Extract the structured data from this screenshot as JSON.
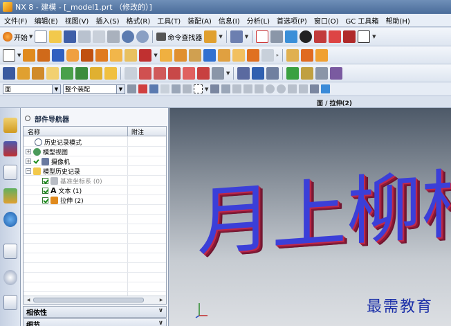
{
  "window": {
    "title": "NX 8 - 建模 - [_model1.prt （修改的）]"
  },
  "menu": [
    "文件(F)",
    "编辑(E)",
    "视图(V)",
    "插入(S)",
    "格式(R)",
    "工具(T)",
    "装配(A)",
    "信息(I)",
    "分析(L)",
    "首选项(P)",
    "窗口(O)",
    "GC 工具箱",
    "帮助(H)"
  ],
  "toolbar": {
    "start_label": "开始",
    "command_finder_label": "命令查找器"
  },
  "selection": {
    "filter_value": "面",
    "scope_value": "整个装配"
  },
  "status": {
    "cue": "面 / 拉伸(2)"
  },
  "navigator": {
    "title": "部件导航器",
    "columns": [
      "名称",
      "附注"
    ],
    "nodes": [
      {
        "label": "历史记录模式",
        "state": "normal"
      },
      {
        "label": "模型视图",
        "state": "normal"
      },
      {
        "label": "摄像机",
        "state": "normal"
      },
      {
        "label": "模型历史记录",
        "state": "normal"
      },
      {
        "label": "基准坐标系 (0)",
        "state": "dim"
      },
      {
        "label": "文本 (1)",
        "state": "normal"
      },
      {
        "label": "拉伸 (2)",
        "state": "normal"
      }
    ],
    "panels": [
      "相依性",
      "细节"
    ]
  },
  "graphics": {
    "model_text": "月上柳梢头"
  },
  "watermark": "最需教育",
  "colors": {
    "extrude_face": "#3b3fd8",
    "extrude_edge": "#c0284a",
    "title_bar": "#4a6c9a"
  }
}
